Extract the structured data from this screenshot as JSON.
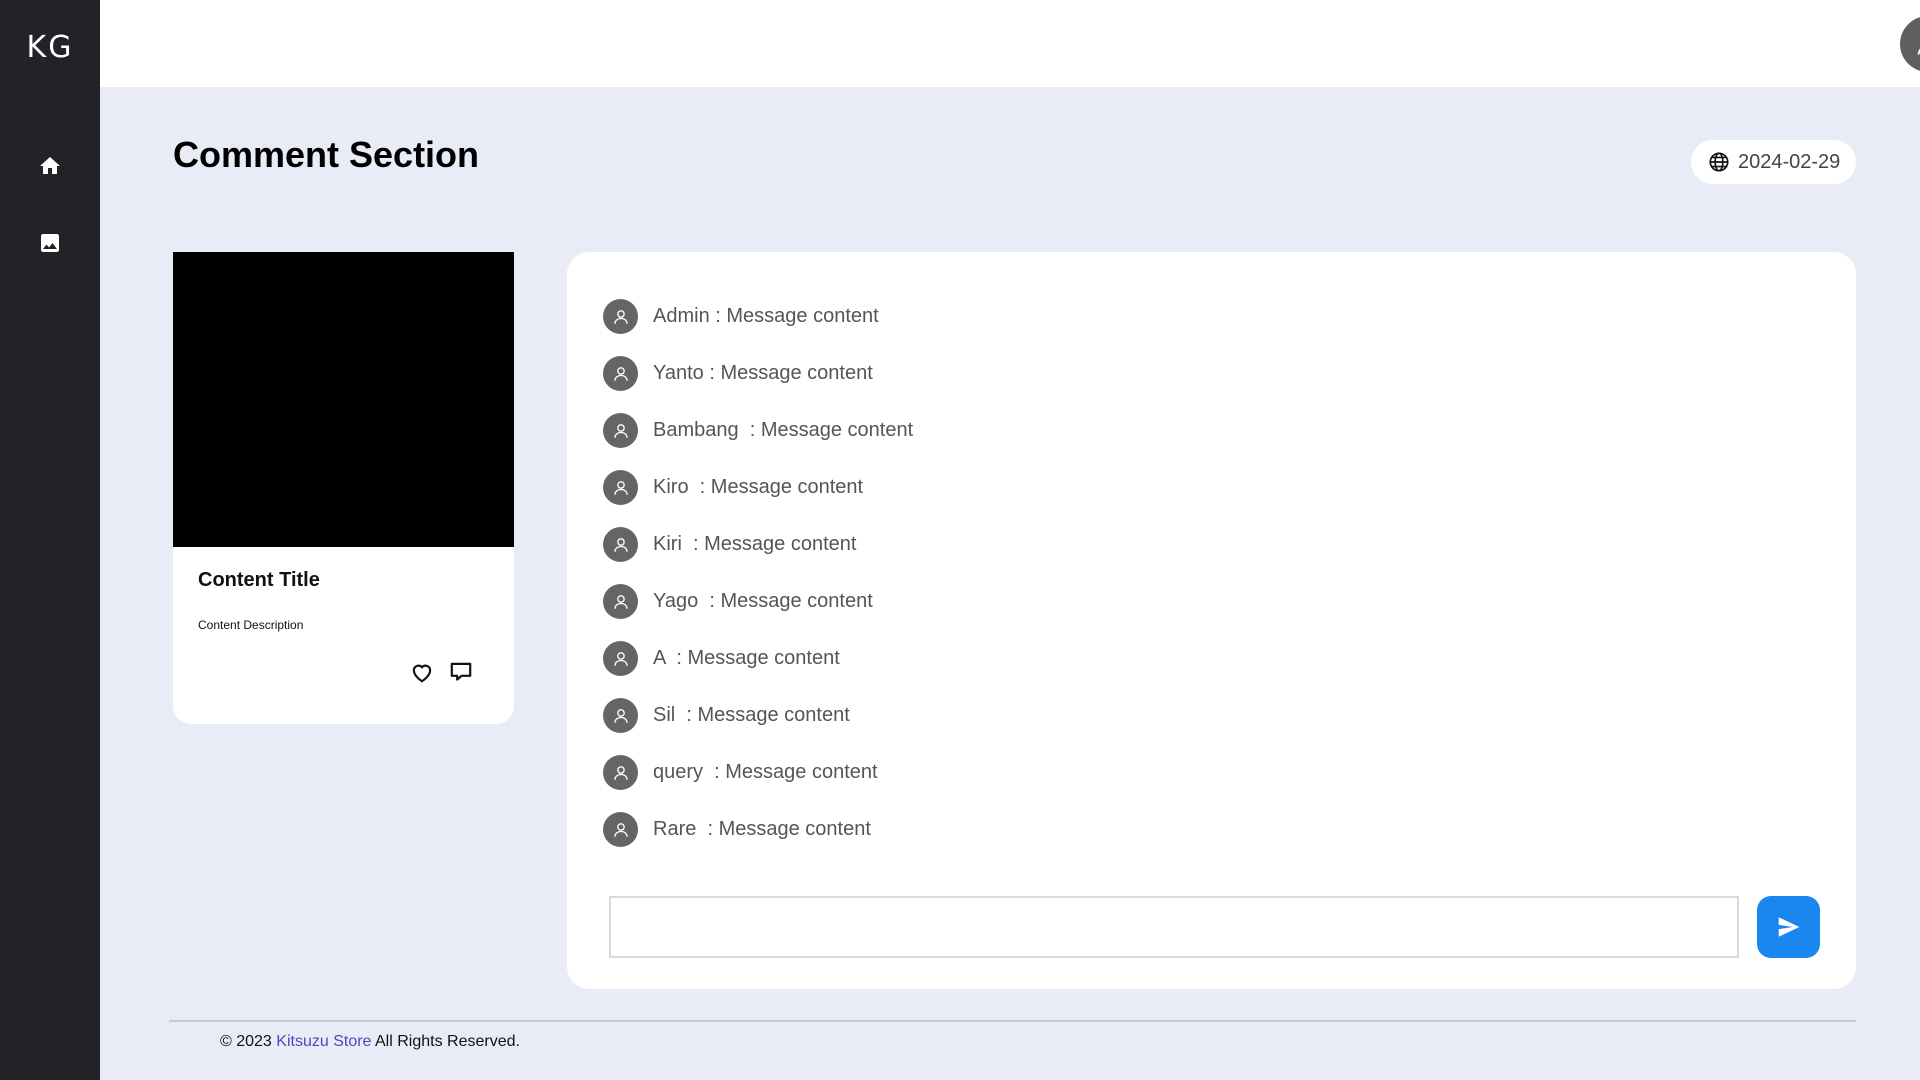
{
  "sidebar": {
    "logo": "KG",
    "items": [
      {
        "icon": "home-icon"
      },
      {
        "icon": "image-icon"
      }
    ]
  },
  "header": {
    "avatar_icon": "user-icon"
  },
  "page": {
    "title": "Comment Section",
    "date": "2024-02-29"
  },
  "card": {
    "title": "Content Title",
    "description": "Content Description",
    "actions": [
      "heart-icon",
      "comment-icon"
    ]
  },
  "comments": [
    {
      "text": "Admin : Message content"
    },
    {
      "text": "Yanto : Message content"
    },
    {
      "text": "Bambang  : Message content"
    },
    {
      "text": "Kiro  : Message content"
    },
    {
      "text": "Kiri  : Message content"
    },
    {
      "text": "Yago  : Message content"
    },
    {
      "text": "A  : Message content"
    },
    {
      "text": "Sil  : Message content"
    },
    {
      "text": "query  : Message content"
    },
    {
      "text": "Rare  : Message content"
    }
  ],
  "composer": {
    "value": "",
    "placeholder": "",
    "send_icon": "send-icon"
  },
  "footer": {
    "prefix": "© 2023 ",
    "link": "Kitsuzu Store",
    "suffix": " All Rights Reserved."
  },
  "colors": {
    "sidebar": "#232327",
    "background": "#e9ecf6",
    "accent": "#1a86f0",
    "avatar": "#656565",
    "link": "#4a4ab8"
  }
}
